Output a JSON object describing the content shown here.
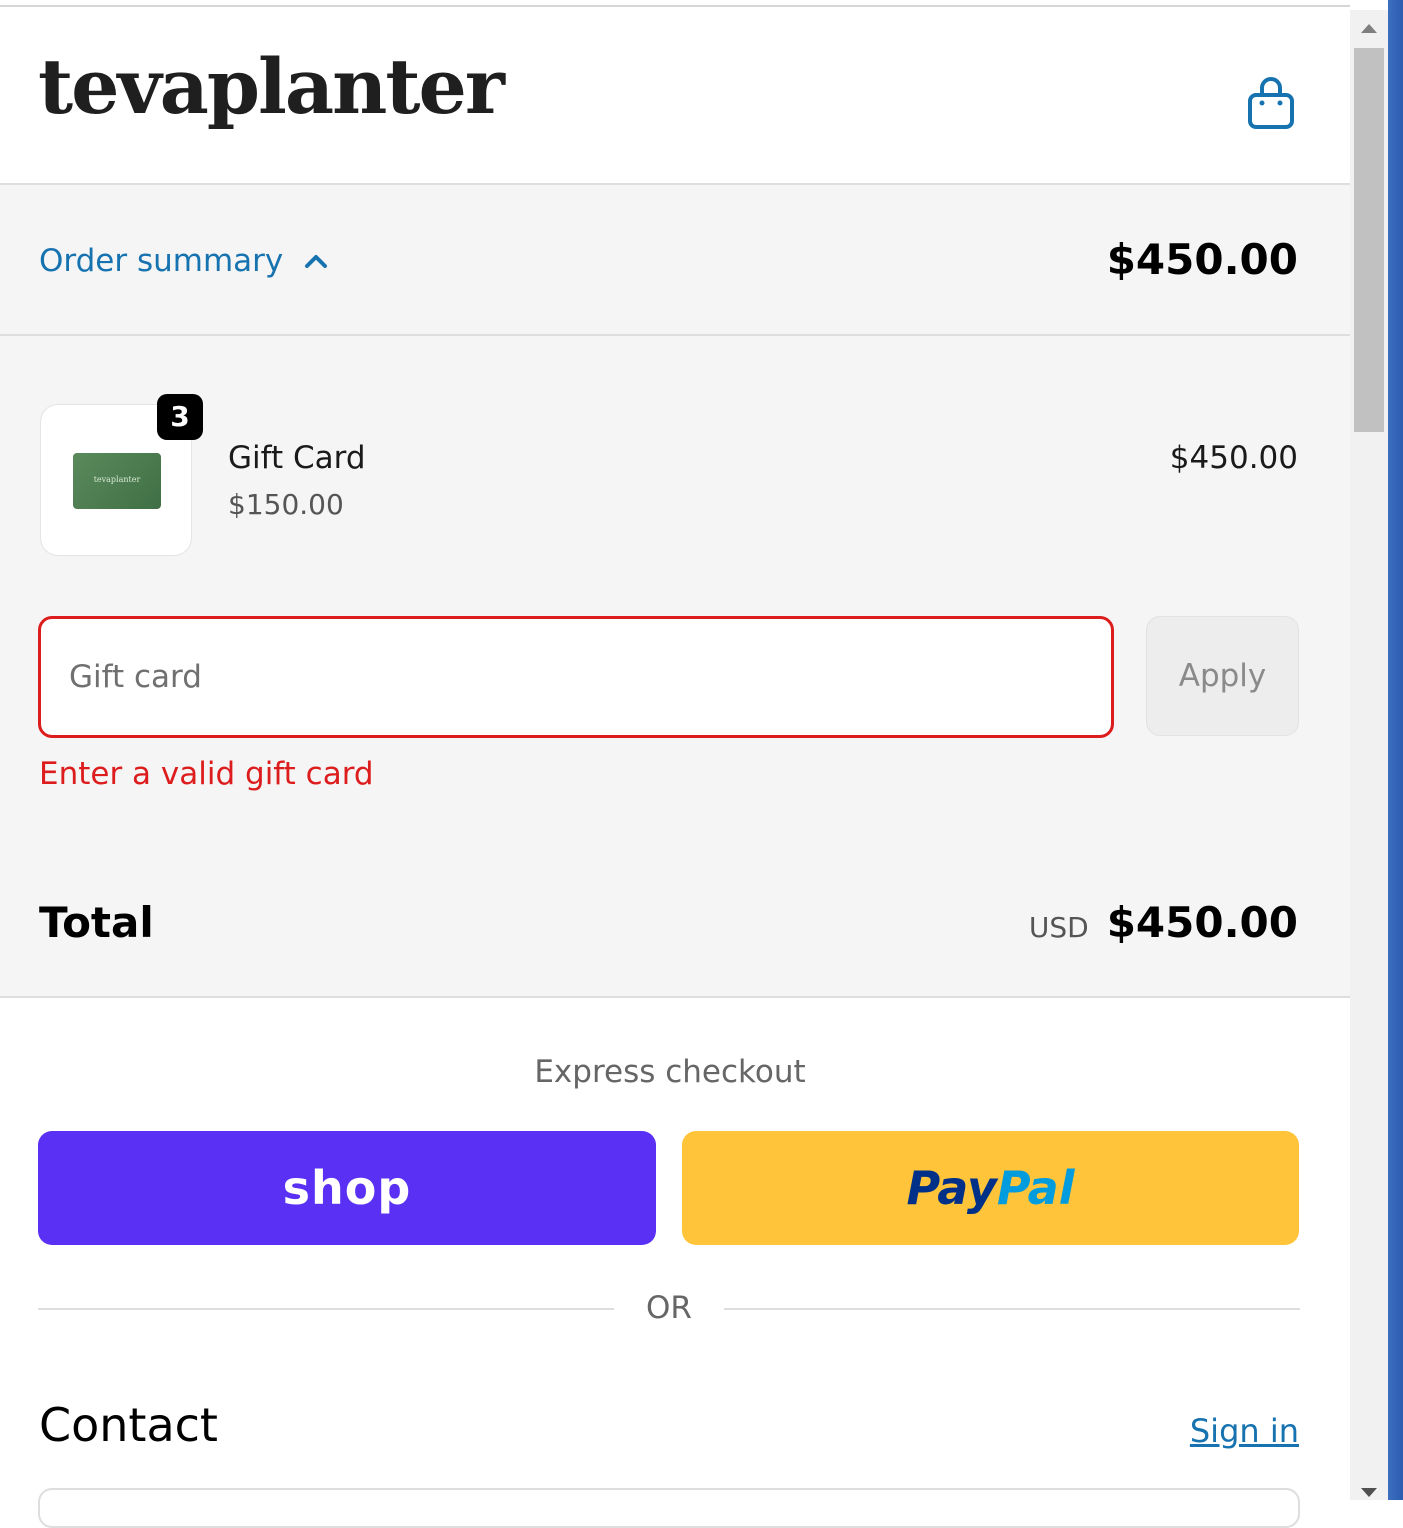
{
  "header": {
    "logo_text": "tevaplanter",
    "cart_icon": "shopping-bag-icon"
  },
  "summary": {
    "toggle_label": "Order summary",
    "toggle_icon": "chevron-up-icon",
    "total": "$450.00"
  },
  "line_item": {
    "name": "Gift Card",
    "unit_price": "$150.00",
    "quantity": "3",
    "line_total": "$450.00",
    "thumb_text": "tevaplanter"
  },
  "gift_card": {
    "placeholder": "Gift card",
    "apply_label": "Apply",
    "error": "Enter a valid gift card"
  },
  "totals": {
    "label": "Total",
    "currency": "USD",
    "value": "$450.00"
  },
  "express": {
    "title": "Express checkout",
    "shop_label": "shop",
    "paypal_part1": "Pay",
    "paypal_part2": "Pal",
    "or": "OR"
  },
  "contact": {
    "title": "Contact",
    "sign_in": "Sign in"
  },
  "colors": {
    "link": "#1773b0",
    "error": "#dd1d1d",
    "shop": "#5a31f4",
    "paypal": "#ffc439"
  }
}
